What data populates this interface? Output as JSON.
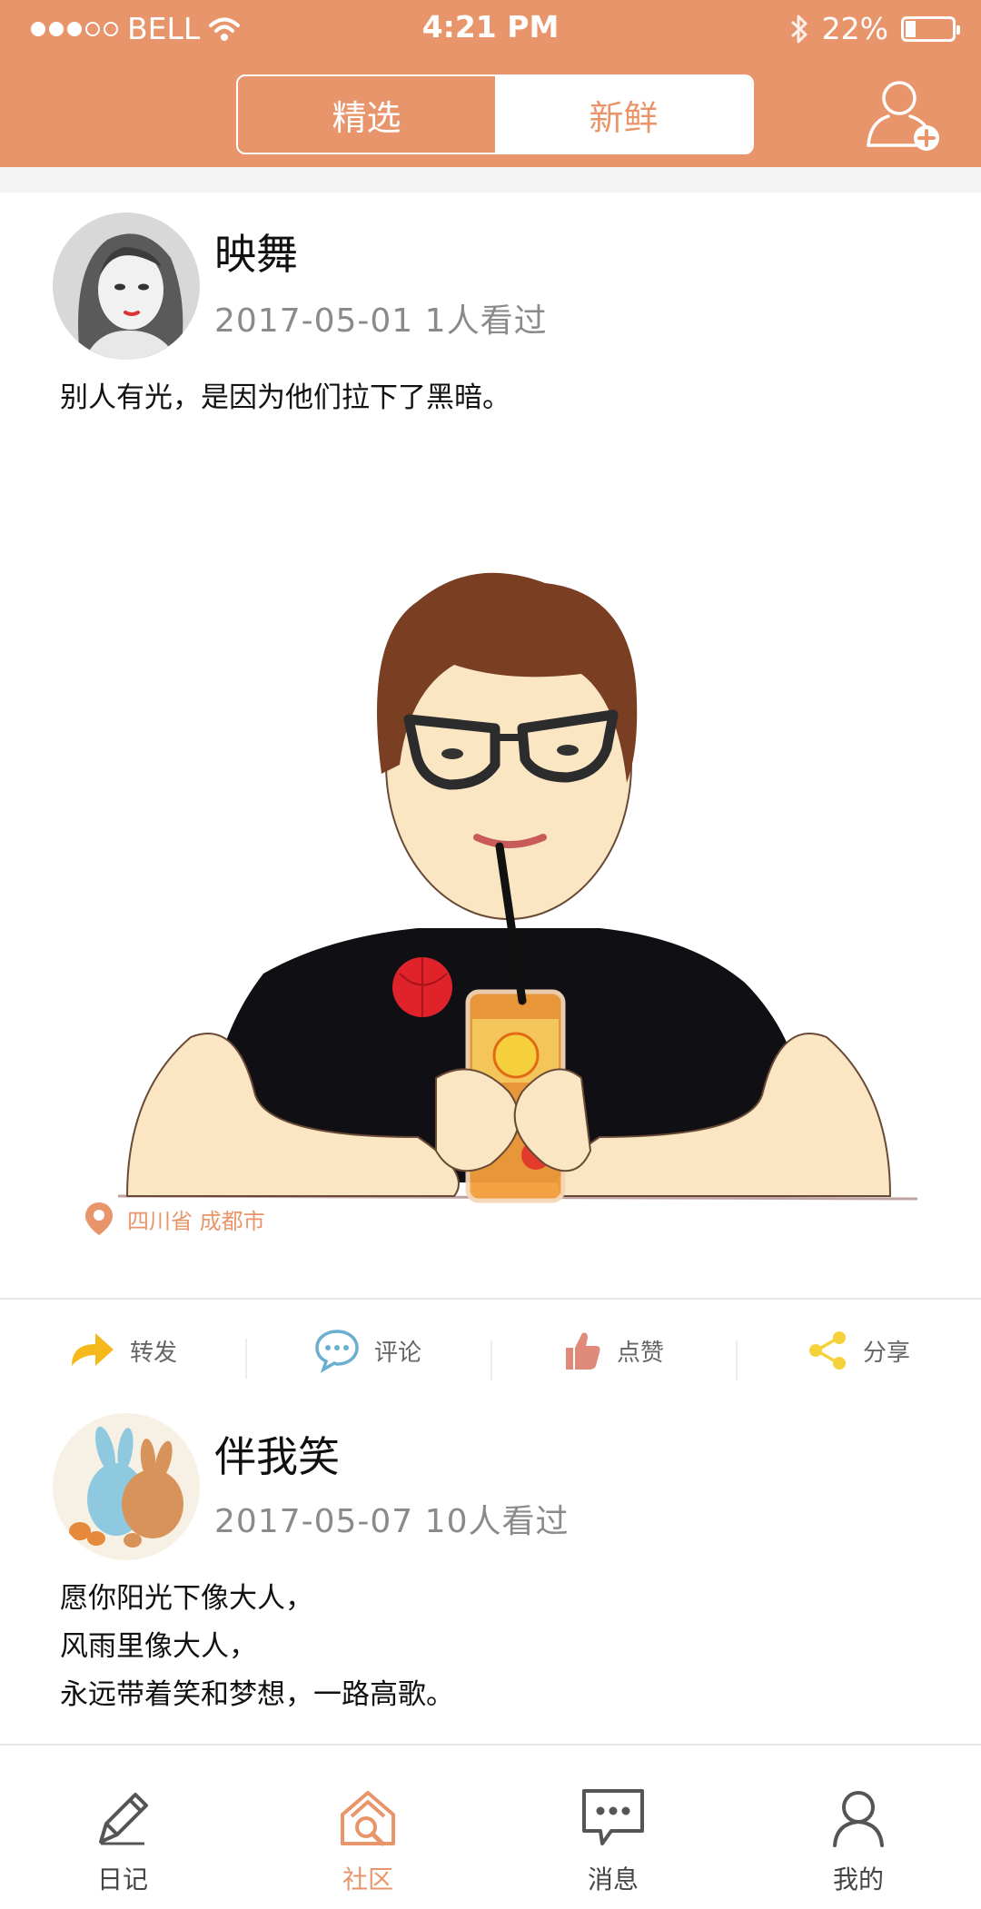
{
  "status_bar": {
    "carrier": "BELL",
    "time": "4:21 PM",
    "battery": "22%",
    "battery_level": 0.22,
    "signal_filled": 3,
    "signal_total": 5
  },
  "header": {
    "tabs": [
      {
        "label": "精选",
        "active": false
      },
      {
        "label": "新鲜",
        "active": true
      }
    ],
    "add_user_icon": "add-user-icon",
    "accent_color": "#E9956B"
  },
  "posts": [
    {
      "username": "映舞",
      "date": "2017-05-01",
      "views": "1人看过",
      "text": [
        "别人有光，是因为他们拉下了黑暗。"
      ],
      "location": "四川省  成都市",
      "actions": [
        "转发",
        "评论",
        "点赞",
        "分享"
      ]
    },
    {
      "username": "伴我笑",
      "date": "2017-05-07",
      "views": "10人看过",
      "text": [
        "愿你阳光下像大人，",
        "风雨里像大人，",
        "永远带着笑和梦想，一路高歌。"
      ]
    }
  ],
  "tab_bar": {
    "items": [
      {
        "label": "日记",
        "icon": "pencil-icon",
        "active": false
      },
      {
        "label": "社区",
        "icon": "community-home-icon",
        "active": true
      },
      {
        "label": "消息",
        "icon": "message-icon",
        "active": false
      },
      {
        "label": "我的",
        "icon": "profile-icon",
        "active": false
      }
    ]
  }
}
